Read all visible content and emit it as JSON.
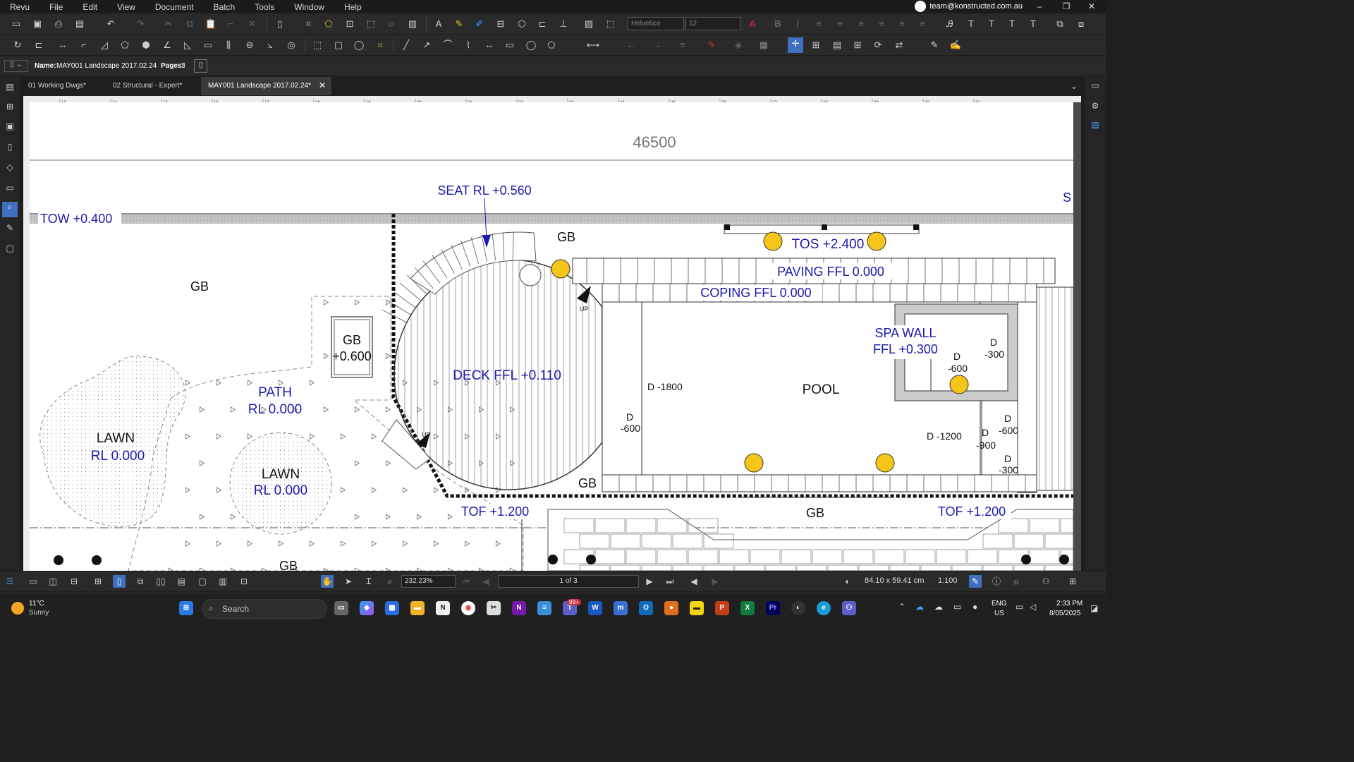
{
  "menu": {
    "items": [
      "Revu",
      "File",
      "Edit",
      "View",
      "Document",
      "Batch",
      "Tools",
      "Window",
      "Help"
    ],
    "account_email": "team@konstructed.com.au"
  },
  "window_controls": {
    "minimize": "–",
    "restore": "❐",
    "close": "✕"
  },
  "format": {
    "font_name": "Helvetica",
    "font_size": "12"
  },
  "infobar": {
    "name_label": "Name:",
    "name_value": "MAY001 Landscape 2017.02.24",
    "pages_label": "Pages:",
    "pages_value": "3"
  },
  "tabs": [
    {
      "label": "01 Working Dwgs*"
    },
    {
      "label": "02 Structural - Expert*"
    },
    {
      "label": "MAY001 Landscape 2017.02.24*"
    }
  ],
  "ruler": {
    "ticks": [
      "13",
      "14",
      "15",
      "16",
      "17",
      "18",
      "19",
      "20",
      "21",
      "22",
      "23",
      "24",
      "25",
      "26",
      "27",
      "28",
      "29",
      "30",
      "31"
    ]
  },
  "drawing": {
    "dimension": "46500",
    "labels": {
      "tow": "TOW +0.400",
      "seat": "SEAT RL +0.560",
      "gb": "GB",
      "tos": "TOS +2.400",
      "paving": "PAVING FFL 0.000",
      "coping": "COPING FFL 0.000",
      "spa_wall_1": "SPA WALL",
      "spa_wall_2": "FFL +0.300",
      "deck": "DECK FFL +0.110",
      "pool": "POOL",
      "path_1": "PATH",
      "path_2": "RL 0.000",
      "lawn": "LAWN",
      "lawn_rl": "RL 0.000",
      "gb_600": "+0.600",
      "tof": "TOF +1.200",
      "up": "UP",
      "d_1800": "D -1800",
      "d_1200": "D -1200",
      "d": "D",
      "m600": "-600",
      "m300": "-300",
      "m900": "-900",
      "s": "S"
    }
  },
  "status": {
    "zoom": "232.23%",
    "page": "1 of 3",
    "dimensions": "84.10 x 59.41 cm",
    "scale": "1:100"
  },
  "taskbar": {
    "weather_temp": "11°C",
    "weather_cond": "Sunny",
    "search": "Search",
    "badge": "99+",
    "lang_1": "ENG",
    "lang_2": "US",
    "time": "2:33 PM",
    "date": "8/05/2025"
  },
  "colors": {
    "annotation_blue": "#1a1ab0",
    "light_fill": "#f5c518",
    "chrome_dark": "#2a2a2a"
  }
}
